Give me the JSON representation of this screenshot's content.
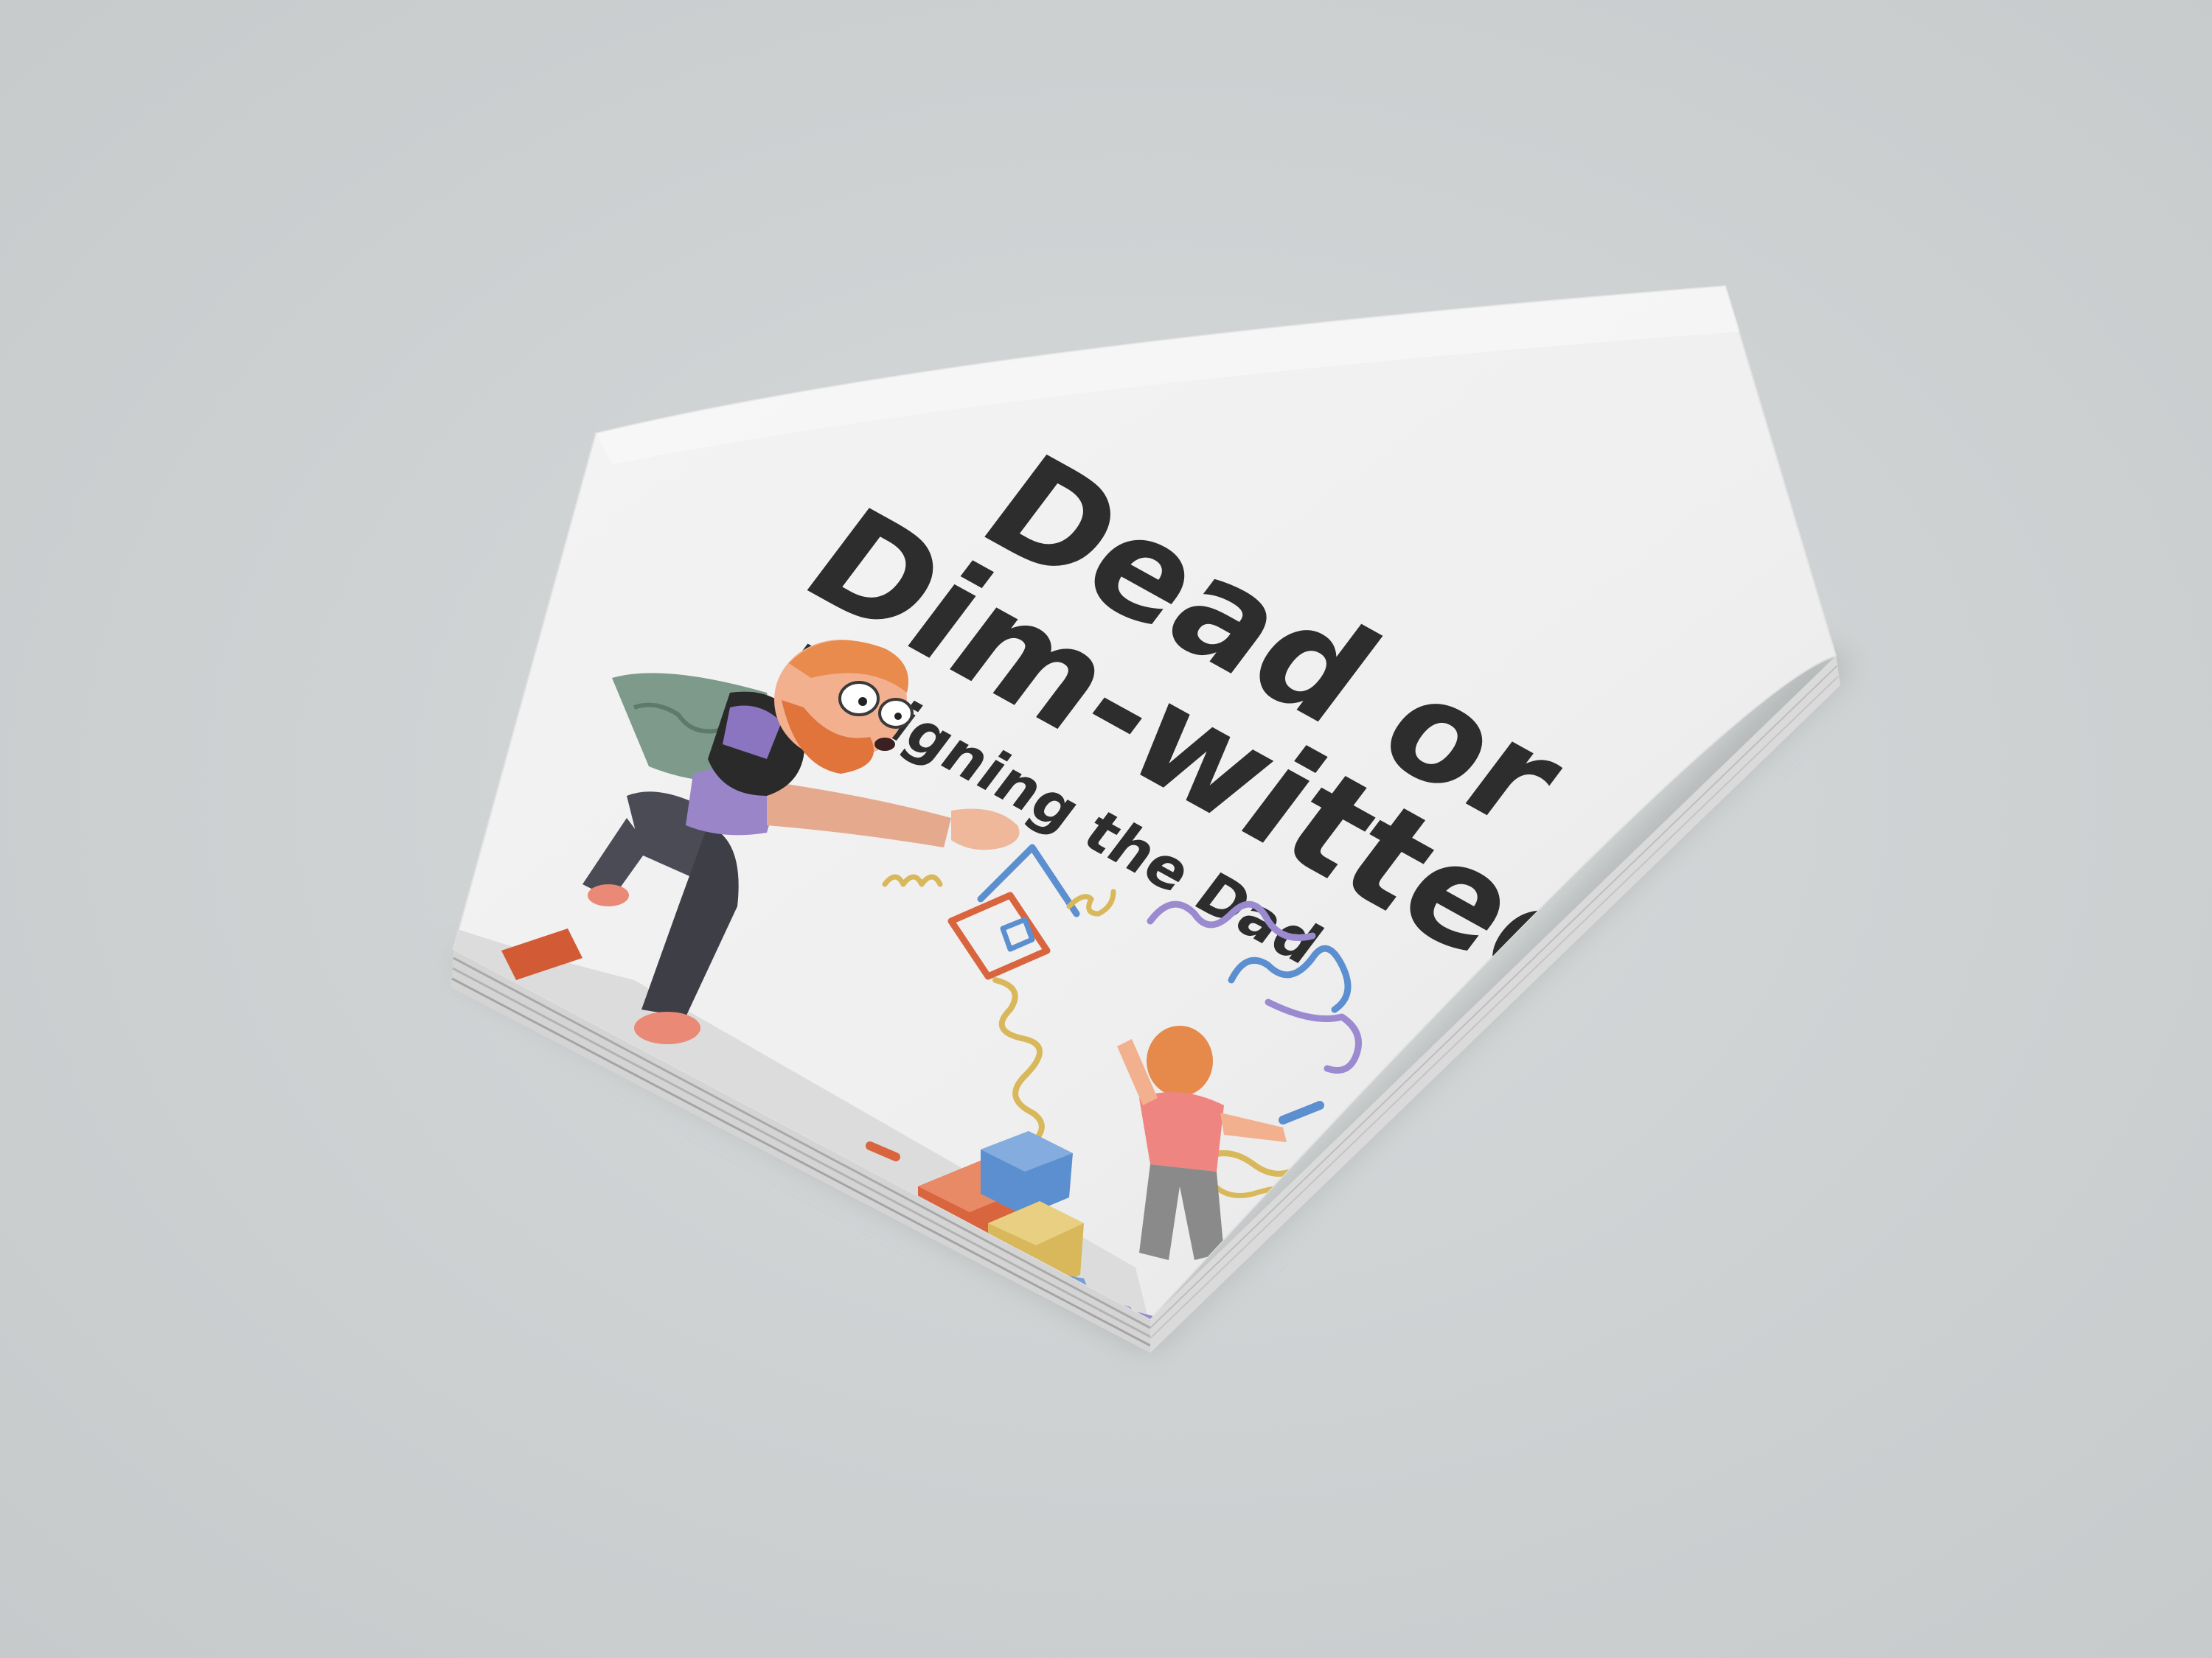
{
  "booklet": {
    "title_line1": "Dead or",
    "title_line2": "Dim-witted:",
    "subtitle": "Designing the Dad"
  },
  "colors": {
    "background": "#cfd3d4",
    "cover": "#efefef",
    "title_ink": "#2d2d2d",
    "crayon_orange": "#d9653f",
    "crayon_blue": "#5b8fd0",
    "crayon_purple": "#9b8ad0",
    "crayon_yellow": "#d8b85a"
  }
}
